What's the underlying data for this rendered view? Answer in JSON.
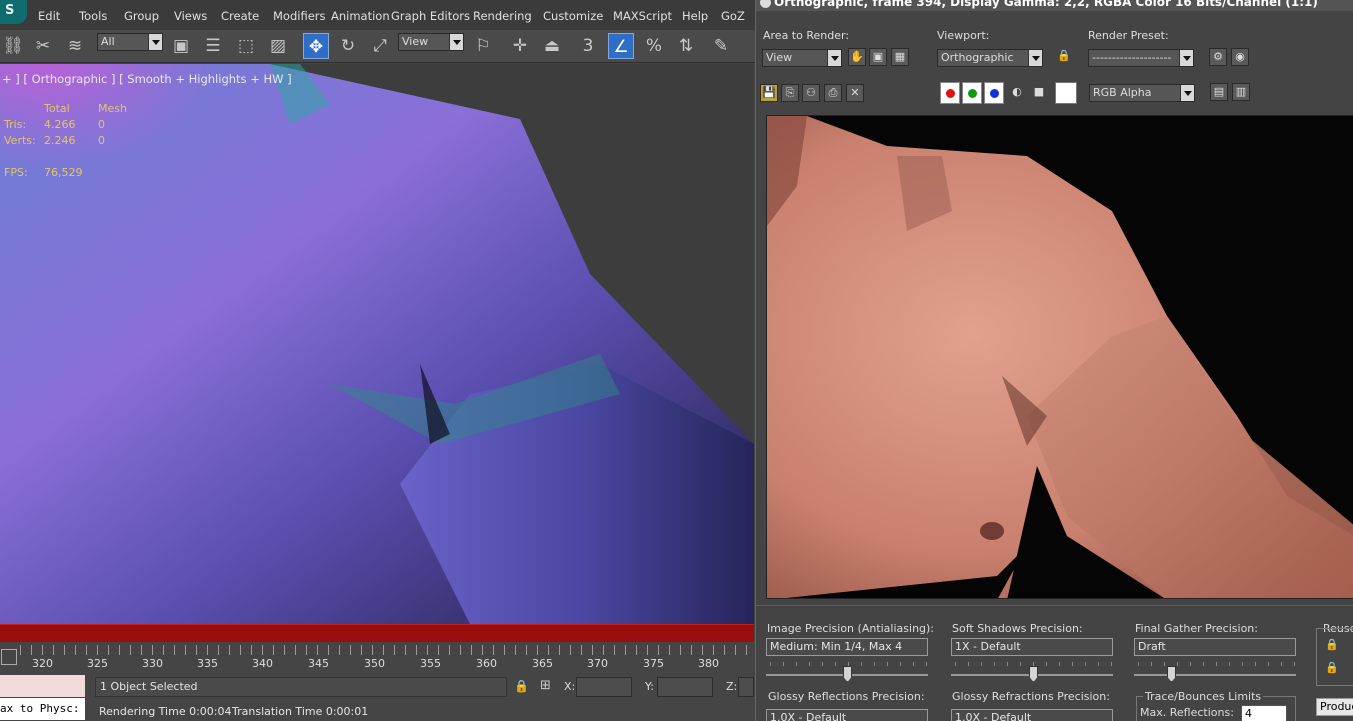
{
  "app": {
    "logo_text": "S"
  },
  "menu": [
    "Edit",
    "Tools",
    "Group",
    "Views",
    "Create",
    "Modifiers",
    "Animation",
    "Graph Editors",
    "Rendering",
    "Customize",
    "MAXScript",
    "Help",
    "GoZ"
  ],
  "toolbar": {
    "selection_filter": "All",
    "reference_coord": "View",
    "snap_label": "3",
    "percent_snap": "%"
  },
  "viewport": {
    "label": "+ ] [ Orthographic ] [ Smooth + Highlights + HW ]",
    "stats": {
      "col_total": "Total",
      "col_mesh": "Mesh",
      "tris_label": "Tris:",
      "tris_total": "4.266",
      "tris_mesh": "0",
      "verts_label": "Verts:",
      "verts_total": "2.246",
      "verts_mesh": "0",
      "fps_label": "FPS:",
      "fps_value": "76,529"
    }
  },
  "timeline": {
    "ticks": [
      "320",
      "325",
      "330",
      "335",
      "340",
      "345",
      "350",
      "355",
      "360",
      "365",
      "370",
      "375",
      "380"
    ]
  },
  "status": {
    "script_output": "ax to Physc:",
    "selection": "1 Object Selected",
    "x_label": "X:",
    "y_label": "Y:",
    "z_label": "Z:",
    "rendering_time": "Rendering Time  0:00:04",
    "translation_time": "Translation Time  0:00:01"
  },
  "render_window": {
    "title": "Orthographic, frame 394, Display Gamma: 2,2, RGBA Color 16 Bits/Channel (1:1)",
    "area_label": "Area to Render:",
    "area_value": "View",
    "viewport_label": "Viewport:",
    "viewport_value": "Orthographic",
    "preset_label": "Render Preset:",
    "preset_value": "--------------------",
    "channel_value": "RGB Alpha",
    "channel_colors": {
      "red": "#e01010",
      "green": "#109a10",
      "blue": "#1030e0"
    }
  },
  "render_settings": {
    "image_precision_label": "Image Precision (Antialiasing):",
    "image_precision_value": "Medium: Min 1/4, Max 4",
    "soft_shadows_label": "Soft Shadows Precision:",
    "soft_shadows_value": "1X - Default",
    "final_gather_label": "Final Gather Precision:",
    "final_gather_value": "Draft",
    "reuse_label": "Reuse",
    "glossy_refl_label": "Glossy Reflections Precision:",
    "glossy_refl_value": "1.0X - Default",
    "glossy_refr_label": "Glossy Refractions Precision:",
    "glossy_refr_value": "1.0X - Default",
    "trace_label": "Trace/Bounces Limits",
    "max_refl_label": "Max. Reflections:",
    "max_refl_value": "4",
    "production_label": "Produc"
  }
}
